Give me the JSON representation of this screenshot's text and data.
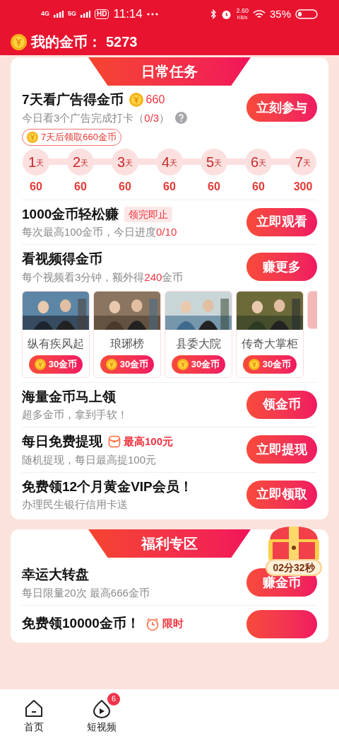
{
  "status_bar": {
    "network_1": "4G",
    "network_2": "5G",
    "hd": "HD",
    "time": "11:14",
    "net_speed": "2.60",
    "net_unit": "KB/s",
    "battery": "35%"
  },
  "header": {
    "label": "我的金币：",
    "value": "5273"
  },
  "daily": {
    "title": "日常任务",
    "tasks": [
      {
        "kind": "checkin",
        "title": "7天看广告得金币",
        "reward": "660",
        "subtitle": [
          {
            "text": "今日看3个广告完成打卡（",
            "highlight": false
          },
          {
            "text": "0/3",
            "highlight": true
          },
          {
            "text": "）",
            "highlight": false
          }
        ],
        "button": "立刻参与",
        "bubble": "7天后领取660金币",
        "days": [
          {
            "day": "1",
            "unit": "天",
            "reward": "60"
          },
          {
            "day": "2",
            "unit": "天",
            "reward": "60"
          },
          {
            "day": "3",
            "unit": "天",
            "reward": "60"
          },
          {
            "day": "4",
            "unit": "天",
            "reward": "60"
          },
          {
            "day": "5",
            "unit": "天",
            "reward": "60"
          },
          {
            "day": "6",
            "unit": "天",
            "reward": "60"
          },
          {
            "day": "7",
            "unit": "天",
            "reward": "300"
          }
        ]
      },
      {
        "kind": "plain",
        "title": "1000金币轻松赚",
        "tag": {
          "kind": "label",
          "text": "领完即止"
        },
        "subtitle": [
          {
            "text": "每次最高100金币，今日进度",
            "highlight": false
          },
          {
            "text": "0/10",
            "highlight": true
          }
        ],
        "button": "立即观看"
      },
      {
        "kind": "videos",
        "title": "看视频得金币",
        "subtitle": [
          {
            "text": "每个视频看3分钟，额外得",
            "highlight": false
          },
          {
            "text": "240",
            "highlight": true
          },
          {
            "text": "金币",
            "highlight": false
          }
        ],
        "button": "赚更多",
        "videos": [
          {
            "name": "纵有疾风起",
            "reward": "30金币"
          },
          {
            "name": "琅琊榜",
            "reward": "30金币"
          },
          {
            "name": "县委大院",
            "reward": "30金币"
          },
          {
            "name": "传奇大掌柜",
            "reward": "30金币"
          }
        ]
      },
      {
        "kind": "plain",
        "title": "海量金币马上领",
        "subtitle": [
          {
            "text": "超多金币，拿到手软！",
            "highlight": false
          }
        ],
        "button": "领金币"
      },
      {
        "kind": "plain",
        "title": "每日免费提现",
        "tag": {
          "kind": "envelope",
          "text": "最高100元"
        },
        "subtitle": [
          {
            "text": "随机提现，每日最高提100元",
            "highlight": false
          }
        ],
        "button": "立即提现"
      },
      {
        "kind": "plain",
        "title": "免费领12个月黄金VIP会员！",
        "subtitle": [
          {
            "text": "办理民生银行信用卡送",
            "highlight": false
          }
        ],
        "button": "立即领取"
      }
    ]
  },
  "welfare": {
    "title": "福利专区",
    "timer": "02分32秒",
    "tasks": [
      {
        "title": "幸运大转盘",
        "subtitle": [
          {
            "text": "每日限量20次 最高666金币",
            "highlight": false
          }
        ],
        "button": "赚金币"
      },
      {
        "title": "免费领10000金币！",
        "tag": {
          "kind": "clock",
          "text": "限时"
        }
      }
    ]
  },
  "bottom_nav": [
    {
      "kind": "home",
      "label": "首页"
    },
    {
      "kind": "video",
      "label": "短视频",
      "badge": "6"
    }
  ]
}
